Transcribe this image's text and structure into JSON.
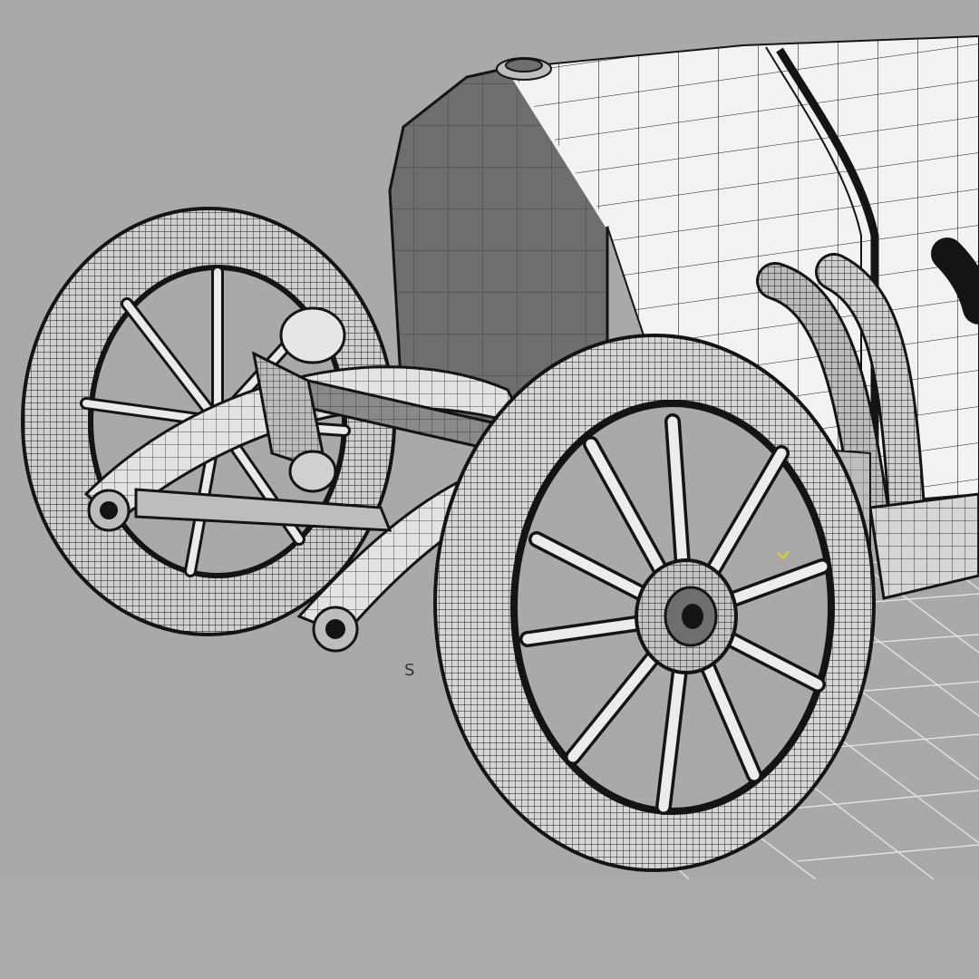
{
  "viewport": {
    "mode": "wireframe-shaded",
    "background_color": "#a9a9a9",
    "footer_band_color": "#aaaaaa",
    "wire_color": "#141414",
    "surface_light": "#f2f2f2",
    "surface_mid": "#bdbdbd",
    "surface_dark": "#6e6e6e",
    "grid_color": "#e6e6e6",
    "gizmo_color": "#e3d21c"
  },
  "axis_marker": {
    "label": "S"
  },
  "model": {
    "parts": [
      "radiator",
      "hood",
      "fuel-cap",
      "exhaust-pipes",
      "muffler",
      "front-axle",
      "leaf-spring",
      "steering-box",
      "wheel-front-left",
      "wheel-front-right"
    ]
  }
}
